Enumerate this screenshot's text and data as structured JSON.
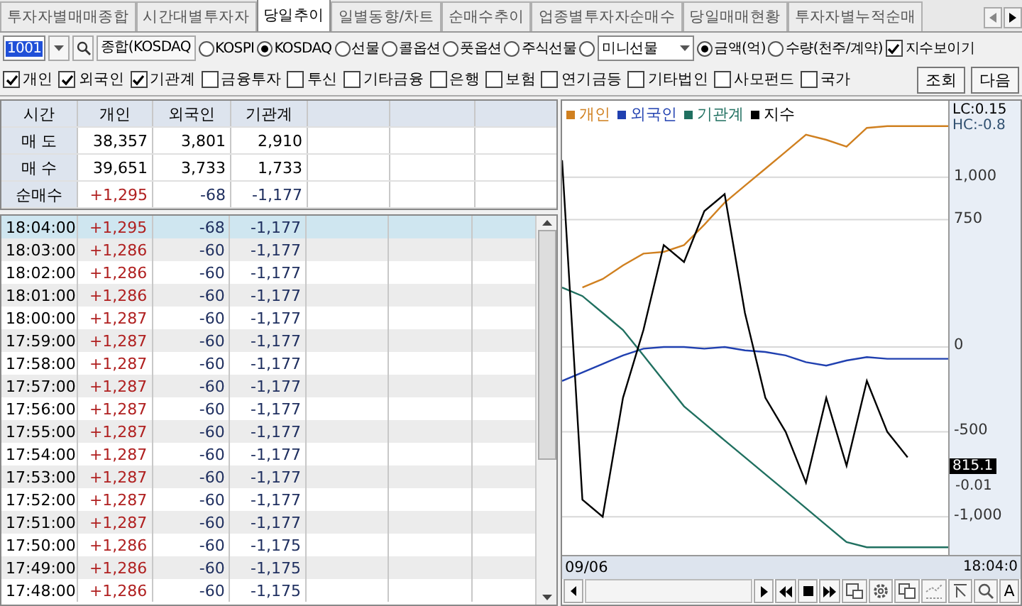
{
  "tabs": [
    {
      "label": "투자자별매매종합",
      "selected": false
    },
    {
      "label": "시간대별투자자",
      "selected": false
    },
    {
      "label": "당일추이",
      "selected": true
    },
    {
      "label": "일별동향/차트",
      "selected": false
    },
    {
      "label": "순매수추이",
      "selected": false
    },
    {
      "label": "업종별투자자순매수",
      "selected": false
    },
    {
      "label": "당일매매현황",
      "selected": false
    },
    {
      "label": "투자자별누적순매",
      "selected": false
    }
  ],
  "controls": {
    "code": "1001",
    "market_name": "종합(KOSDAQ",
    "markets": [
      {
        "label": "KOSPI",
        "selected": false
      },
      {
        "label": "KOSDAQ",
        "selected": true
      },
      {
        "label": "선물",
        "selected": false
      },
      {
        "label": "콜옵션",
        "selected": false
      },
      {
        "label": "풋옵션",
        "selected": false
      },
      {
        "label": "주식선물",
        "selected": false
      },
      {
        "selected": false,
        "select": "미니선물"
      }
    ],
    "units": [
      {
        "label": "금액(억)",
        "selected": true
      },
      {
        "label": "수량(천주/계약)",
        "selected": false
      }
    ],
    "show_index": {
      "label": "지수보이기",
      "checked": true
    }
  },
  "investors": [
    {
      "label": "개인",
      "checked": true
    },
    {
      "label": "외국인",
      "checked": true
    },
    {
      "label": "기관계",
      "checked": true
    },
    {
      "label": "금융투자",
      "checked": false
    },
    {
      "label": "투신",
      "checked": false
    },
    {
      "label": "기타금융",
      "checked": false
    },
    {
      "label": "은행",
      "checked": false
    },
    {
      "label": "보험",
      "checked": false
    },
    {
      "label": "연기금등",
      "checked": false
    },
    {
      "label": "기타법인",
      "checked": false
    },
    {
      "label": "사모펀드",
      "checked": false
    },
    {
      "label": "국가",
      "checked": false
    }
  ],
  "buttons": [
    "조회",
    "다음"
  ],
  "summary": {
    "columns": [
      {
        "label": "시간"
      },
      {
        "label": "개인",
        "color": "#b02020"
      },
      {
        "label": "외국인",
        "color": "#203060"
      },
      {
        "label": "기관계",
        "color": "#203060"
      }
    ],
    "rows": [
      {
        "cells": [
          "매 도",
          "38,357",
          "3,801",
          "2,910"
        ],
        "signed": false
      },
      {
        "cells": [
          "매 수",
          "39,651",
          "3,733",
          "1,733"
        ],
        "signed": false
      },
      {
        "cells": [
          "순매수",
          "+1,295",
          "-68",
          "-1,177"
        ],
        "signed": true
      }
    ]
  },
  "timeline": [
    {
      "cells": [
        "18:04:00",
        "+1,295",
        "-68",
        "-1,177"
      ],
      "selected": true
    },
    {
      "cells": [
        "18:03:00",
        "+1,286",
        "-60",
        "-1,177"
      ],
      "selected": false
    },
    {
      "cells": [
        "18:02:00",
        "+1,286",
        "-60",
        "-1,177"
      ],
      "selected": false
    },
    {
      "cells": [
        "18:01:00",
        "+1,286",
        "-60",
        "-1,177"
      ],
      "selected": false
    },
    {
      "cells": [
        "18:00:00",
        "+1,287",
        "-60",
        "-1,177"
      ],
      "selected": false
    },
    {
      "cells": [
        "17:59:00",
        "+1,287",
        "-60",
        "-1,177"
      ],
      "selected": false
    },
    {
      "cells": [
        "17:58:00",
        "+1,287",
        "-60",
        "-1,177"
      ],
      "selected": false
    },
    {
      "cells": [
        "17:57:00",
        "+1,287",
        "-60",
        "-1,177"
      ],
      "selected": false
    },
    {
      "cells": [
        "17:56:00",
        "+1,287",
        "-60",
        "-1,177"
      ],
      "selected": false
    },
    {
      "cells": [
        "17:55:00",
        "+1,287",
        "-60",
        "-1,177"
      ],
      "selected": false
    },
    {
      "cells": [
        "17:54:00",
        "+1,287",
        "-60",
        "-1,177"
      ],
      "selected": false
    },
    {
      "cells": [
        "17:53:00",
        "+1,287",
        "-60",
        "-1,177"
      ],
      "selected": false
    },
    {
      "cells": [
        "17:52:00",
        "+1,287",
        "-60",
        "-1,177"
      ],
      "selected": false
    },
    {
      "cells": [
        "17:51:00",
        "+1,287",
        "-60",
        "-1,177"
      ],
      "selected": false
    },
    {
      "cells": [
        "17:50:00",
        "+1,286",
        "-60",
        "-1,175"
      ],
      "selected": false
    },
    {
      "cells": [
        "17:49:00",
        "+1,286",
        "-60",
        "-1,175"
      ],
      "selected": false
    },
    {
      "cells": [
        "17:48:00",
        "+1,286",
        "-60",
        "-1,175"
      ],
      "selected": false
    }
  ],
  "chart": {
    "lc": "LC:0.15",
    "hc": "HC:-0.8",
    "price": "815.1",
    "change": "-0.01",
    "start_date": "09/06",
    "end_time": "18:04:0",
    "font_button": "A",
    "chart_data": {
      "type": "line",
      "categories": [
        null,
        null,
        null,
        null,
        null,
        null,
        null,
        null,
        null,
        null,
        null,
        null,
        null,
        null,
        null,
        null,
        null,
        null,
        null,
        null
      ],
      "ylim": [
        -1225,
        1450
      ],
      "grid": true,
      "legend": true,
      "yticks": [
        {
          "value": 1000,
          "label": "1,000"
        },
        {
          "value": 750,
          "label": "750"
        },
        {
          "value": 0,
          "label": "0"
        },
        {
          "value": -500,
          "label": "-500"
        },
        {
          "value": -1000,
          "label": "-1,000"
        }
      ],
      "series": [
        {
          "name": "개인",
          "color": "#d08020",
          "values": [
            null,
            350,
            400,
            480,
            550,
            560,
            600,
            720,
            850,
            950,
            1050,
            1150,
            1250,
            1220,
            1180,
            1290,
            1300,
            1300,
            1300,
            1300
          ]
        },
        {
          "name": "외국인",
          "color": "#2040b0",
          "values": [
            -200,
            -150,
            -100,
            -50,
            -10,
            0,
            0,
            -10,
            0,
            -20,
            -30,
            -50,
            -90,
            -110,
            -80,
            -60,
            -70,
            -70,
            -70,
            -70
          ]
        },
        {
          "name": "기관계",
          "color": "#207060",
          "values": [
            350,
            300,
            200,
            100,
            -50,
            -200,
            -350,
            -450,
            -550,
            -650,
            -750,
            -850,
            -950,
            -1050,
            -1150,
            -1180,
            -1180,
            -1180,
            -1180,
            -1180
          ]
        },
        {
          "name": "지수",
          "color": "#000000",
          "values": [
            1100,
            -900,
            -1000,
            -300,
            100,
            600,
            500,
            800,
            900,
            200,
            -300,
            -500,
            -800,
            -300,
            -700,
            -200,
            -500,
            -650,
            null,
            null
          ]
        }
      ]
    }
  }
}
